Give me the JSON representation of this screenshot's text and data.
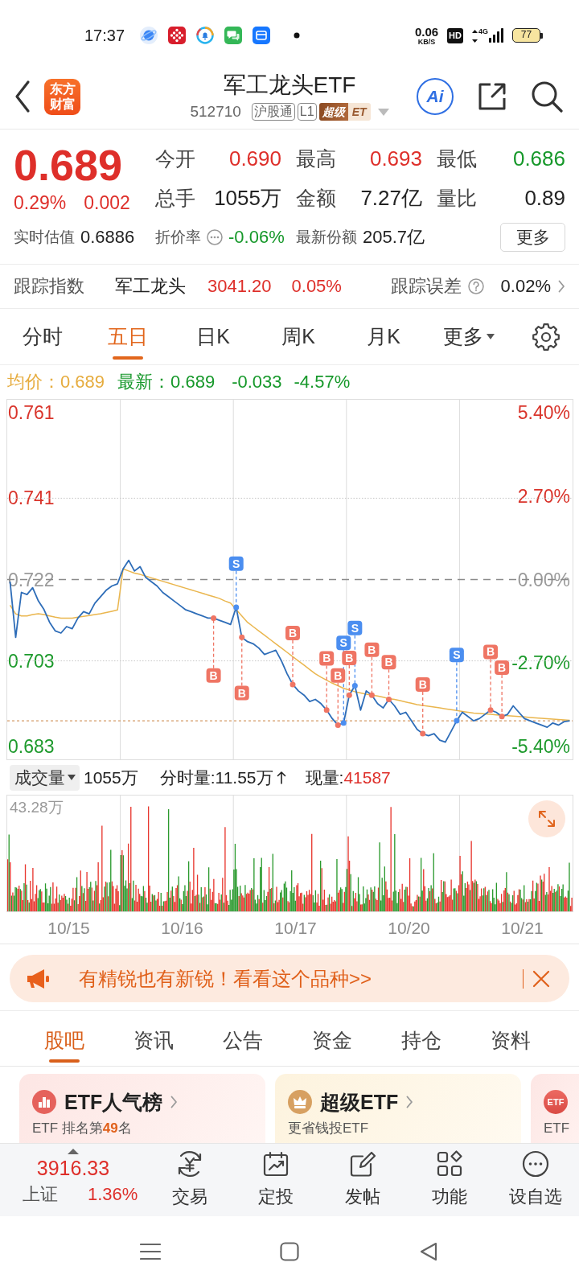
{
  "status_bar": {
    "time": "17:37",
    "net_speed": "0.06",
    "net_unit": "KB/S",
    "hd_badge": "HD",
    "network": "4G",
    "battery": "77"
  },
  "header": {
    "logo": [
      "东方",
      "财富"
    ],
    "title": "军工龙头ETF",
    "code": "512710",
    "tags": [
      {
        "kind": "outline",
        "text": "沪股通"
      },
      {
        "kind": "outline",
        "text": "L1"
      },
      {
        "kind": "premium",
        "text": "超级",
        "extra": "ET"
      }
    ],
    "assistant": "Ai"
  },
  "quote": {
    "price": "0.689",
    "change_pct": "0.29%",
    "change": "0.002",
    "rising": true,
    "stats": [
      {
        "label": "今开",
        "value": "0.690",
        "color": "#de2f2a"
      },
      {
        "label": "最高",
        "value": "0.693",
        "color": "#de2f2a"
      },
      {
        "label": "最低",
        "value": "0.686",
        "color": "#16982a"
      },
      {
        "label": "总手",
        "value": "1055万",
        "color": "#222222"
      },
      {
        "label": "金额",
        "value": "7.27亿",
        "color": "#222222"
      },
      {
        "label": "量比",
        "value": "0.89",
        "color": "#222222"
      }
    ],
    "details": [
      {
        "label": "实时估值",
        "value": "0.6886",
        "color": "#222222",
        "info": false
      },
      {
        "label": "折价率",
        "value": "-0.06%",
        "color": "#16982a",
        "info": true
      },
      {
        "label": "最新份额",
        "value": "205.7亿",
        "color": "#222222",
        "info": false
      }
    ],
    "more_button": "更多"
  },
  "tracking": {
    "label": "跟踪指数",
    "index_name": "军工龙头",
    "index_value": "3041.20",
    "index_change": "0.05%",
    "rising": true,
    "error_label": "跟踪误差",
    "error_value": "0.02%"
  },
  "chart_tabs": [
    {
      "kind": "tab",
      "label": "分时",
      "selected": false
    },
    {
      "kind": "tab",
      "label": "五日",
      "selected": true
    },
    {
      "kind": "tab",
      "label": "日K",
      "selected": false
    },
    {
      "kind": "tab",
      "label": "周K",
      "selected": false
    },
    {
      "kind": "tab",
      "label": "月K",
      "selected": false
    },
    {
      "kind": "menu",
      "label": "更多",
      "selected": false
    }
  ],
  "legend": {
    "average": "均价：0.689",
    "latest": "最新：0.689",
    "change": "-0.033",
    "change_pct": "-4.57%",
    "rising": false
  },
  "price_chart": {
    "chart_data": {
      "type": "line",
      "ylim": [
        0.68,
        0.764
      ],
      "yticks": [
        {
          "value": 0.761,
          "label": "0.761"
        },
        {
          "value": 0.741,
          "label": "0.741"
        },
        {
          "value": 0.722,
          "label": "0.722"
        },
        {
          "value": 0.703,
          "label": "0.703"
        },
        {
          "value": 0.683,
          "label": "0.683"
        }
      ],
      "y2lim": [
        -5.82,
        5.82
      ],
      "y2ticks": [
        {
          "value": 5.4,
          "label": "5.40%"
        },
        {
          "value": 2.7,
          "label": "2.70%"
        },
        {
          "value": 0,
          "label": "0.00%"
        },
        {
          "value": -2.7,
          "label": "-2.70%"
        },
        {
          "value": -5.4,
          "label": "-5.40%"
        }
      ],
      "ref_lines": [
        {
          "axis": "y",
          "value": 0.722
        },
        {
          "axis": "y",
          "value": 0.689
        }
      ],
      "series": [
        {
          "color": "#2e6db8",
          "values": [
            0.7215,
            0.7085,
            0.719,
            0.7185,
            0.7201,
            0.717,
            0.715,
            0.712,
            0.71,
            0.7095,
            0.711,
            0.7105,
            0.713,
            0.7145,
            0.714,
            0.7165,
            0.718,
            0.7195,
            0.7205,
            0.721,
            0.7245,
            0.7265,
            0.724,
            0.725,
            0.7225,
            0.7215,
            0.7205,
            0.719,
            0.718,
            0.717,
            0.716,
            0.715,
            0.7145,
            0.714,
            0.7135,
            0.713,
            0.713,
            0.7125,
            0.712,
            0.7115,
            0.7155,
            0.7085,
            0.7075,
            0.707,
            0.706,
            0.7045,
            0.705,
            0.7055,
            0.703,
            0.7,
            0.6975,
            0.696,
            0.695,
            0.6935,
            0.694,
            0.693,
            0.6915,
            0.6895,
            0.688,
            0.6885,
            0.695,
            0.6972,
            0.6915,
            0.696,
            0.695,
            0.693,
            0.692,
            0.694,
            0.6925,
            0.6905,
            0.691,
            0.689,
            0.687,
            0.686,
            0.6855,
            0.686,
            0.6845,
            0.684,
            0.6865,
            0.689,
            0.691,
            0.69,
            0.689,
            0.6895,
            0.6905,
            0.6915,
            0.691,
            0.69,
            0.6905,
            0.6925,
            0.691,
            0.6895,
            0.689,
            0.6885,
            0.688,
            0.6875,
            0.6885,
            0.688,
            0.6888,
            0.689
          ]
        },
        {
          "color": "#eab64e",
          "values": [
            0.716,
            0.714,
            0.7135,
            0.7135,
            0.7138,
            0.714,
            0.7138,
            0.7135,
            0.7132,
            0.713,
            0.713,
            0.713,
            0.7132,
            0.7134,
            0.7136,
            0.7138,
            0.714,
            0.7143,
            0.7146,
            0.7149,
            0.7245,
            0.724,
            0.7235,
            0.7232,
            0.7228,
            0.7224,
            0.722,
            0.7216,
            0.7212,
            0.7208,
            0.7204,
            0.72,
            0.7196,
            0.7192,
            0.7188,
            0.7184,
            0.718,
            0.7176,
            0.717,
            0.7165,
            0.715,
            0.7135,
            0.712,
            0.711,
            0.71,
            0.709,
            0.708,
            0.707,
            0.706,
            0.705,
            0.704,
            0.703,
            0.702,
            0.701,
            0.7,
            0.6992,
            0.6985,
            0.6978,
            0.6972,
            0.6966,
            0.6962,
            0.6958,
            0.6955,
            0.6952,
            0.695,
            0.6948,
            0.6945,
            0.6942,
            0.694,
            0.6937,
            0.6934,
            0.6931,
            0.6928,
            0.6926,
            0.6924,
            0.6922,
            0.692,
            0.6918,
            0.6916,
            0.6914,
            0.6912,
            0.691,
            0.6908,
            0.6907,
            0.6906,
            0.6905,
            0.6904,
            0.6903,
            0.6902,
            0.6901,
            0.69,
            0.6899,
            0.6898,
            0.6897,
            0.6896,
            0.6895,
            0.6894,
            0.6893,
            0.6892,
            0.6891
          ]
        },
        {
          "name": "B",
          "color": "#ef7564",
          "line_style": "dashed",
          "marker": "square",
          "values": [
            null,
            null,
            null,
            null,
            null,
            null,
            null,
            null,
            null,
            null,
            null,
            null,
            null,
            null,
            null,
            null,
            null,
            null,
            null,
            null,
            null,
            null,
            null,
            null,
            null,
            null,
            null,
            null,
            null,
            null,
            null,
            null,
            null,
            null,
            null,
            null,
            0.6996,
            null,
            null,
            null,
            null,
            0.6955,
            null,
            null,
            null,
            null,
            null,
            null,
            null,
            null,
            0.7095,
            null,
            null,
            null,
            null,
            null,
            0.7036,
            null,
            0.6996,
            null,
            0.7037,
            null,
            null,
            null,
            0.7056,
            null,
            null,
            0.7027,
            null,
            null,
            null,
            null,
            null,
            0.6975,
            null,
            null,
            null,
            null,
            null,
            null,
            null,
            null,
            null,
            null,
            null,
            0.7051,
            null,
            0.7014,
            null,
            null,
            null,
            null,
            null,
            null,
            null,
            null,
            null,
            null,
            null,
            null
          ]
        },
        {
          "name": "S",
          "color": "#4b8ef0",
          "line_style": "dashed",
          "marker": "square",
          "values": [
            null,
            null,
            null,
            null,
            null,
            null,
            null,
            null,
            null,
            null,
            null,
            null,
            null,
            null,
            null,
            null,
            null,
            null,
            null,
            null,
            null,
            null,
            null,
            null,
            null,
            null,
            null,
            null,
            null,
            null,
            null,
            null,
            null,
            null,
            null,
            null,
            null,
            null,
            null,
            null,
            0.7257,
            null,
            null,
            null,
            null,
            null,
            null,
            null,
            null,
            null,
            null,
            null,
            null,
            null,
            null,
            null,
            null,
            null,
            null,
            0.7072,
            null,
            0.7107,
            null,
            null,
            null,
            null,
            null,
            null,
            null,
            null,
            null,
            null,
            null,
            null,
            null,
            null,
            null,
            null,
            null,
            0.7044,
            null,
            null,
            null,
            null,
            null,
            null,
            null,
            null,
            null,
            null,
            null,
            null,
            null,
            null,
            null,
            null,
            null,
            null,
            null,
            null
          ]
        }
      ]
    }
  },
  "volume": {
    "selector": "成交量",
    "total": "1055万",
    "interval": "分时量:11.55万",
    "interval_rising": true,
    "current_label": "现量:",
    "current_value": "41587",
    "current_rising": true,
    "max_label": "43.28万",
    "dates": [
      "10/15",
      "10/16",
      "10/17",
      "10/20",
      "10/21"
    ]
  },
  "banner": {
    "text": "有精锐也有新锐！看看这个品种>>"
  },
  "info_tabs": [
    {
      "label": "股吧",
      "selected": true
    },
    {
      "label": "资讯",
      "selected": false
    },
    {
      "label": "公告",
      "selected": false
    },
    {
      "label": "资金",
      "selected": false
    },
    {
      "label": "持仓",
      "selected": false
    },
    {
      "label": "资料",
      "selected": false
    }
  ],
  "cards": [
    {
      "kind": "ranking",
      "title": "ETF人气榜",
      "subtitle": "ETF 排名第**49**名"
    },
    {
      "kind": "premium",
      "title": "超级ETF",
      "subtitle": "更省钱投ETF"
    },
    {
      "kind": "etf",
      "badge": "ETF",
      "subtitle": "ETF"
    }
  ],
  "market_index": {
    "value": "3916.33",
    "name": "上证",
    "change": "1.36%",
    "rising": true
  },
  "bottom_nav": [
    {
      "kind": "trade",
      "label": "交易"
    },
    {
      "kind": "plan",
      "label": "定投"
    },
    {
      "kind": "post",
      "label": "发帖"
    },
    {
      "kind": "apps",
      "label": "功能"
    },
    {
      "kind": "watch",
      "label": "设自选"
    }
  ]
}
